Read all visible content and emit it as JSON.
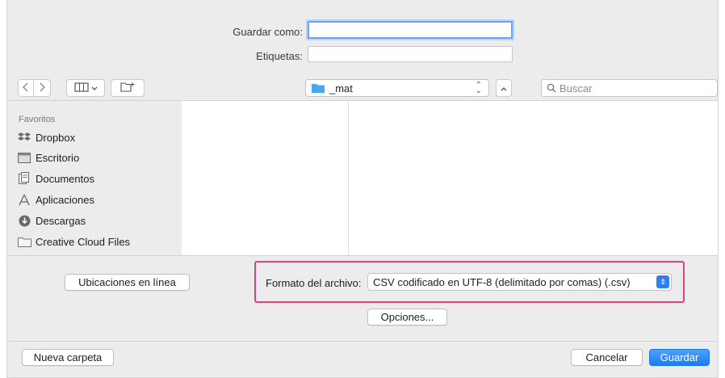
{
  "save_as": {
    "label": "Guardar como:",
    "value": ""
  },
  "tags": {
    "label": "Etiquetas:",
    "value": ""
  },
  "toolbar": {
    "back_icon": "chevron-left-icon",
    "forward_icon": "chevron-right-icon",
    "view_icon": "column-view-icon",
    "new_folder_icon": "new-folder-icon",
    "location": "_mat",
    "search_placeholder": "Buscar"
  },
  "sidebar": {
    "heading": "Favoritos",
    "items": [
      {
        "label": "Dropbox",
        "icon": "dropbox-icon"
      },
      {
        "label": "Escritorio",
        "icon": "desktop-icon"
      },
      {
        "label": "Documentos",
        "icon": "documents-icon"
      },
      {
        "label": "Aplicaciones",
        "icon": "applications-icon"
      },
      {
        "label": "Descargas",
        "icon": "downloads-icon"
      },
      {
        "label": "Creative Cloud Files",
        "icon": "folder-icon"
      }
    ]
  },
  "options_area": {
    "online_locations": "Ubicaciones en línea",
    "format_label": "Formato del archivo:",
    "format_value": "CSV codificado en UTF-8 (delimitado por comas) (.csv)",
    "options_button": "Opciones..."
  },
  "footer": {
    "new_folder": "Nueva carpeta",
    "cancel": "Cancelar",
    "save": "Guardar"
  },
  "colors": {
    "accent": "#1a7cf5",
    "highlight": "#e0407f"
  }
}
